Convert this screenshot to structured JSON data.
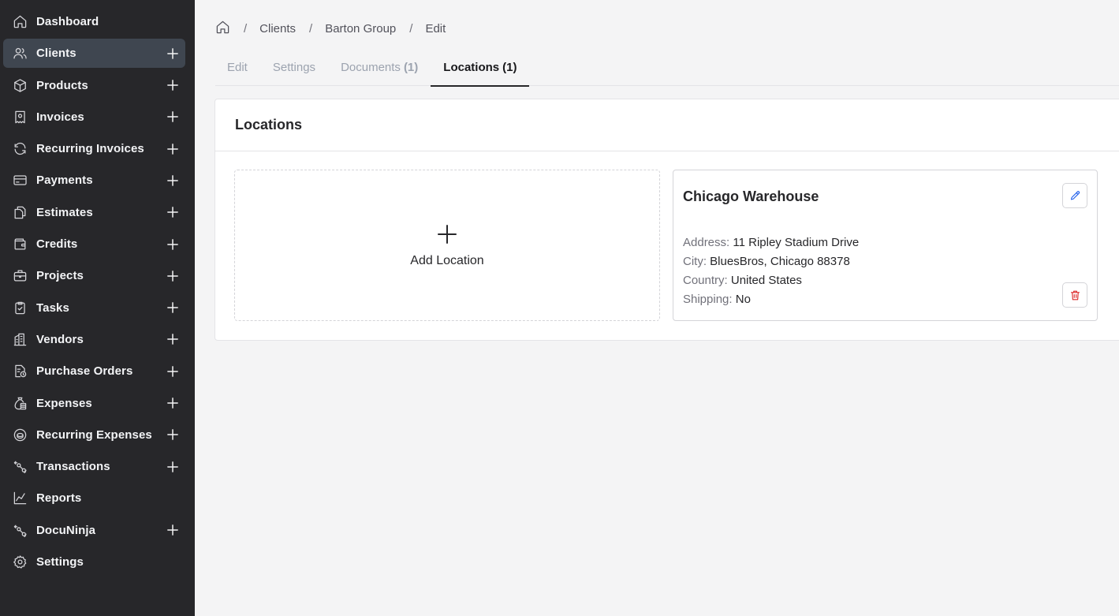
{
  "sidebar": {
    "items": [
      {
        "label": "Dashboard",
        "icon": "home-icon",
        "plus": false,
        "active": false
      },
      {
        "label": "Clients",
        "icon": "users-icon",
        "plus": true,
        "active": true
      },
      {
        "label": "Products",
        "icon": "box-icon",
        "plus": true,
        "active": false
      },
      {
        "label": "Invoices",
        "icon": "receipt-icon",
        "plus": true,
        "active": false
      },
      {
        "label": "Recurring Invoices",
        "icon": "refresh-icon",
        "plus": true,
        "active": false
      },
      {
        "label": "Payments",
        "icon": "credit-card-icon",
        "plus": true,
        "active": false
      },
      {
        "label": "Estimates",
        "icon": "files-icon",
        "plus": true,
        "active": false
      },
      {
        "label": "Credits",
        "icon": "wallet-icon",
        "plus": true,
        "active": false
      },
      {
        "label": "Projects",
        "icon": "briefcase-icon",
        "plus": true,
        "active": false
      },
      {
        "label": "Tasks",
        "icon": "clipboard-check-icon",
        "plus": true,
        "active": false
      },
      {
        "label": "Vendors",
        "icon": "building-icon",
        "plus": true,
        "active": false
      },
      {
        "label": "Purchase Orders",
        "icon": "file-clock-icon",
        "plus": true,
        "active": false
      },
      {
        "label": "Expenses",
        "icon": "money-bag-icon",
        "plus": true,
        "active": false
      },
      {
        "label": "Recurring Expenses",
        "icon": "coin-cycle-icon",
        "plus": true,
        "active": false
      },
      {
        "label": "Transactions",
        "icon": "arrows-exchange-icon",
        "plus": true,
        "active": false
      },
      {
        "label": "Reports",
        "icon": "line-chart-icon",
        "plus": false,
        "active": false
      },
      {
        "label": "DocuNinja",
        "icon": "arrows-exchange-icon",
        "plus": true,
        "active": false
      },
      {
        "label": "Settings",
        "icon": "gear-icon",
        "plus": false,
        "active": false
      }
    ]
  },
  "breadcrumb": {
    "home_icon": "home-icon",
    "separator": "/",
    "items": [
      "Clients",
      "Barton Group",
      "Edit"
    ]
  },
  "tabs": [
    {
      "label": "Edit",
      "count": ""
    },
    {
      "label": "Settings",
      "count": ""
    },
    {
      "label": "Documents",
      "count": "(1)"
    },
    {
      "label": "Locations",
      "count": "(1)",
      "active": true
    }
  ],
  "card": {
    "title": "Locations",
    "add_label": "Add Location",
    "location": {
      "name": "Chicago Warehouse",
      "fields": [
        {
          "key": "Address:",
          "value": "11 Ripley Stadium Drive"
        },
        {
          "key": "City:",
          "value": "BluesBros, Chicago 88378"
        },
        {
          "key": "Country:",
          "value": "United States"
        },
        {
          "key": "Shipping:",
          "value": "No"
        }
      ]
    }
  },
  "colors": {
    "sidebar_bg": "#27272a",
    "sidebar_active": "#3f4650",
    "page_bg": "#f4f4f5",
    "edit_accent": "#2563eb",
    "delete_accent": "#dc2626"
  }
}
